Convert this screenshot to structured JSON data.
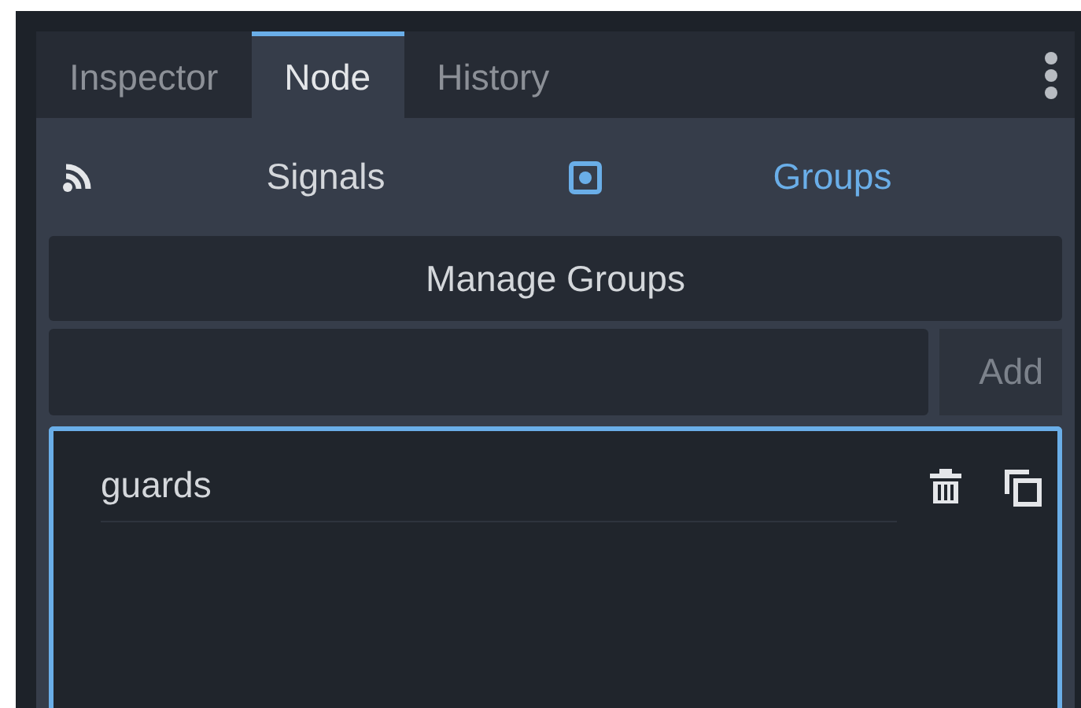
{
  "tabs": [
    {
      "label": "Inspector",
      "selected": false
    },
    {
      "label": "Node",
      "selected": true
    },
    {
      "label": "History",
      "selected": false
    }
  ],
  "modes": [
    {
      "kind": "signals",
      "label": "Signals",
      "selected": false
    },
    {
      "kind": "groups",
      "label": "Groups",
      "selected": true
    }
  ],
  "manage_button": "Manage Groups",
  "add_button": "Add",
  "groups": [
    {
      "name": "guards"
    }
  ]
}
